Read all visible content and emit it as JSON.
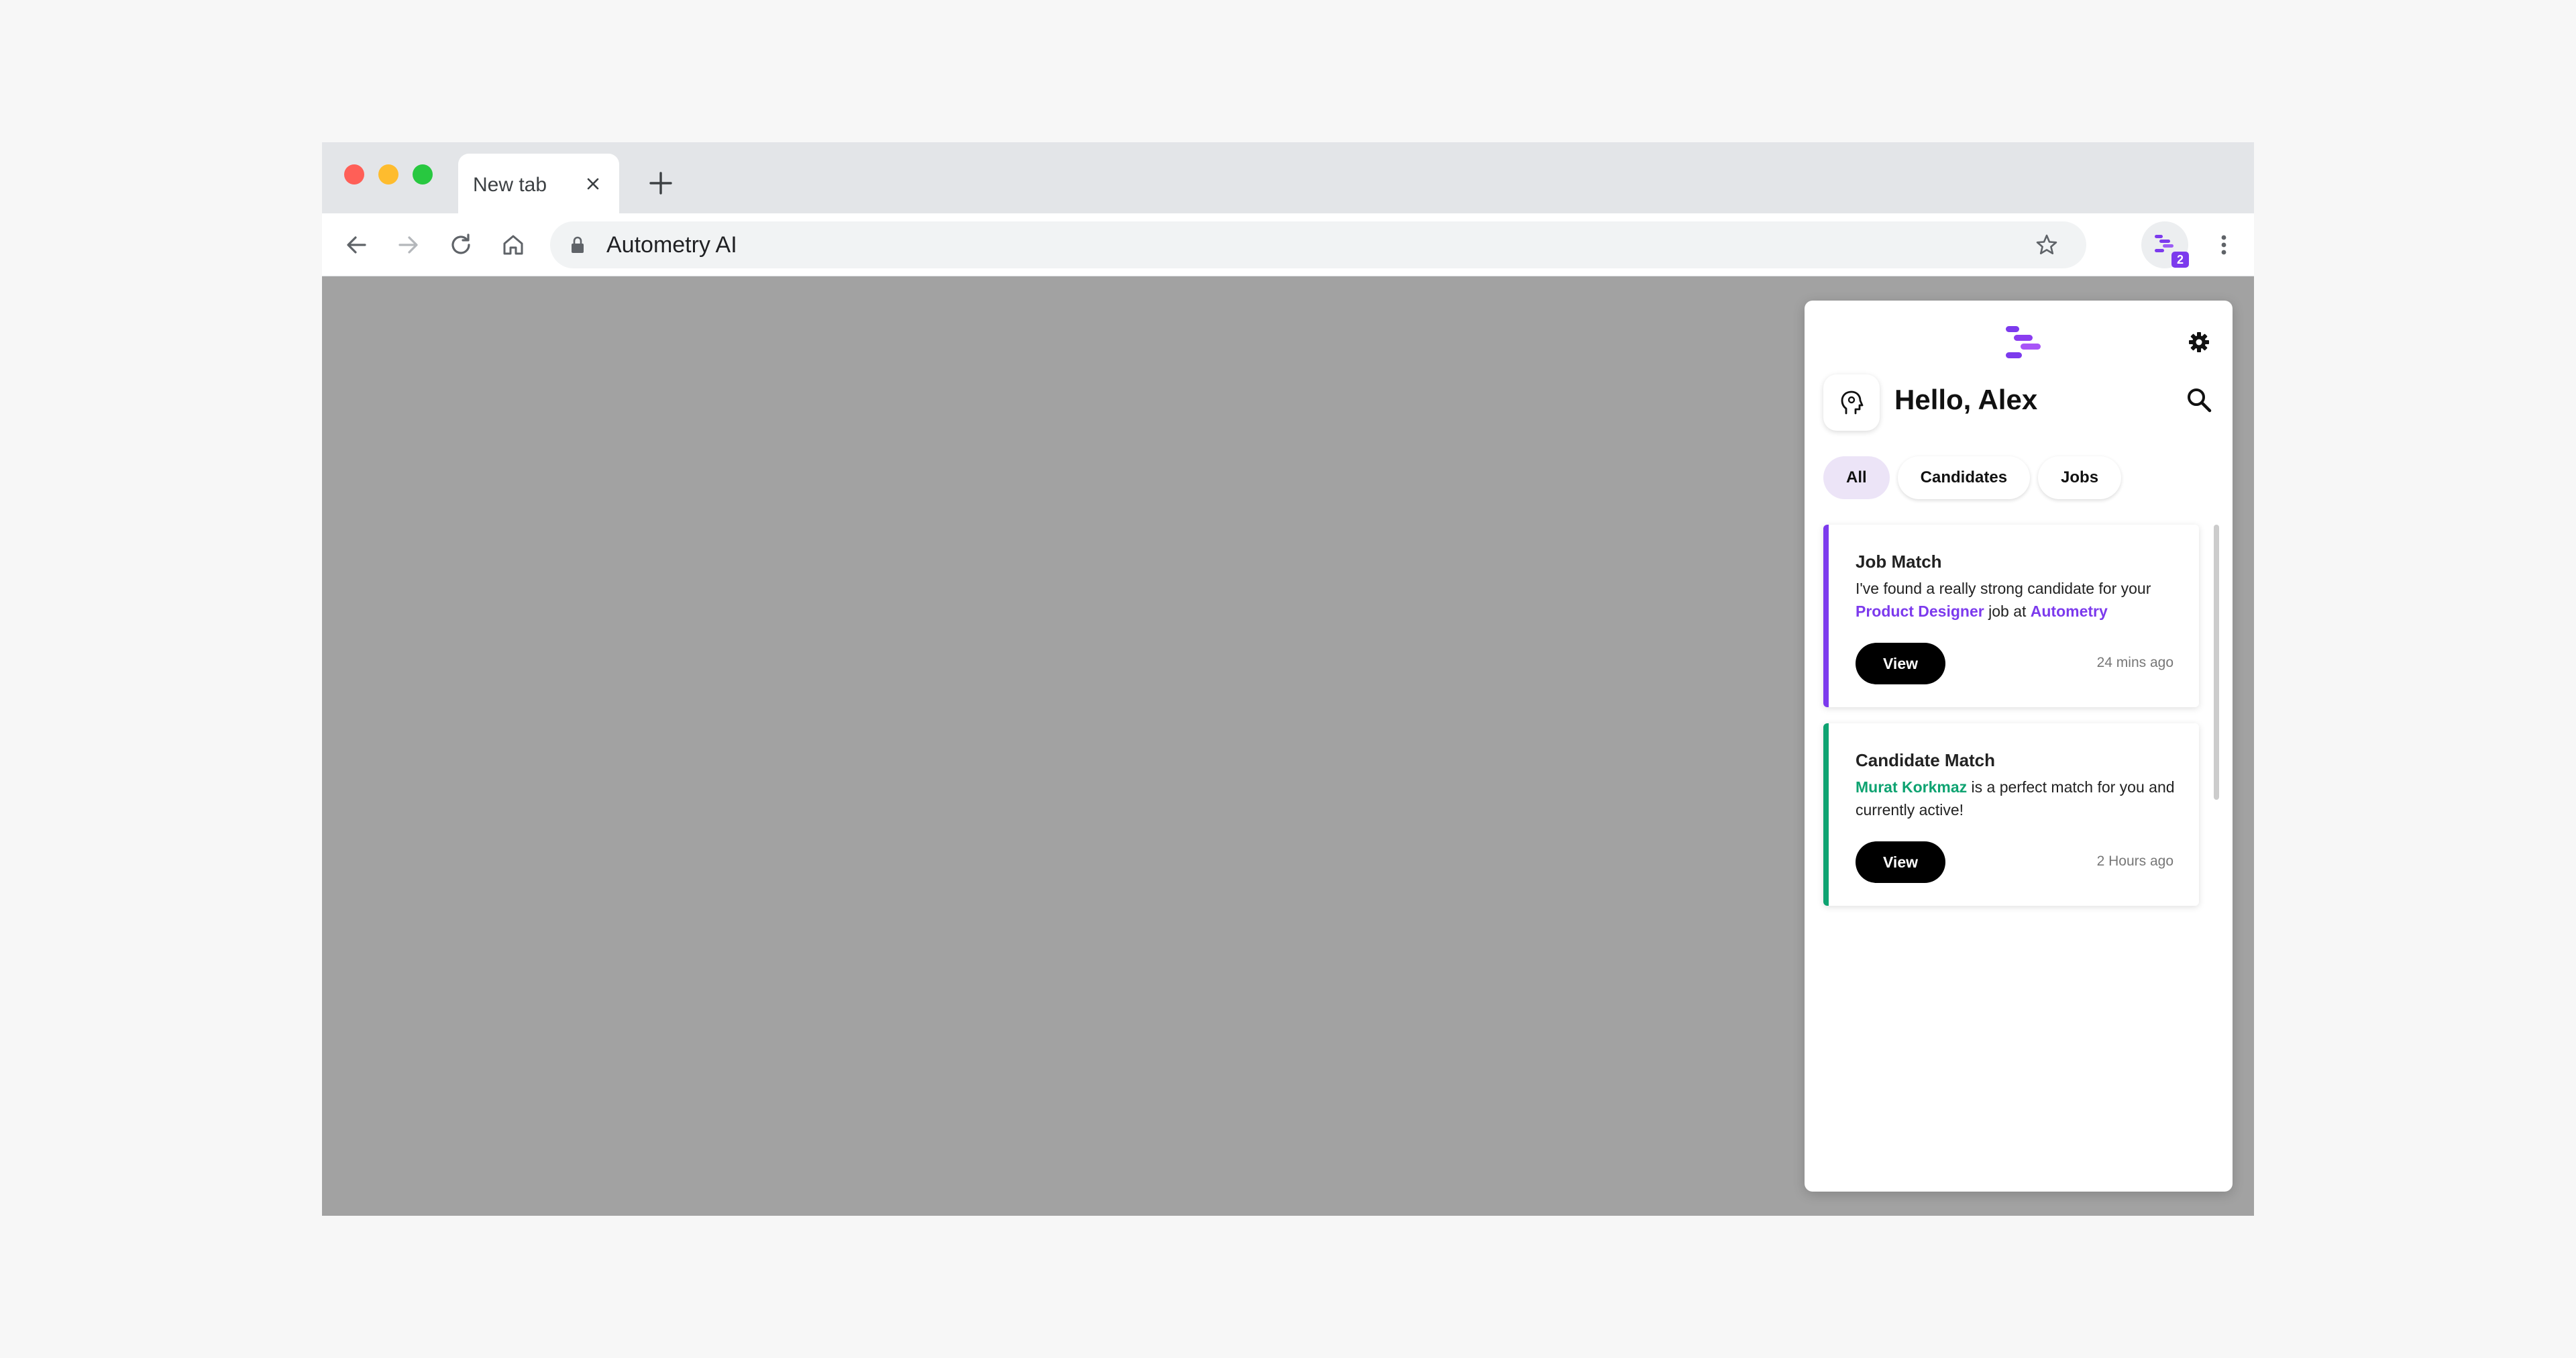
{
  "browser": {
    "tab_title": "New tab",
    "url": "Autometry AI",
    "extension_badge_count": "2",
    "icons": [
      "close-icon",
      "plus-icon",
      "back-arrow-icon",
      "forward-arrow-icon",
      "reload-icon",
      "home-icon",
      "lock-icon",
      "star-icon",
      "kebab-menu-icon"
    ]
  },
  "popup": {
    "greeting": "Hello, Alex",
    "filters": [
      {
        "label": "All",
        "active": true
      },
      {
        "label": "Candidates",
        "active": false
      },
      {
        "label": "Jobs",
        "active": false
      }
    ],
    "notifications": [
      {
        "title": "Job Match",
        "text_1": "I've found a really strong candidate for your ",
        "highlight_1": "Product Designer",
        "text_2": " job at ",
        "highlight_2": "Autometry",
        "button": "View",
        "time": "24 mins ago",
        "accent_color": "#7c3aed"
      },
      {
        "title": "Candidate Match",
        "highlight_1": "Murat Korkmaz",
        "text_1": "  is a perfect match for you and currently active!",
        "button": "View",
        "time": "2 Hours ago",
        "accent_color": "#0ea371"
      }
    ]
  },
  "colors": {
    "brand_purple": "#7c3aed",
    "candidate_green": "#0ea371",
    "content_area": "#a2a2a2"
  }
}
